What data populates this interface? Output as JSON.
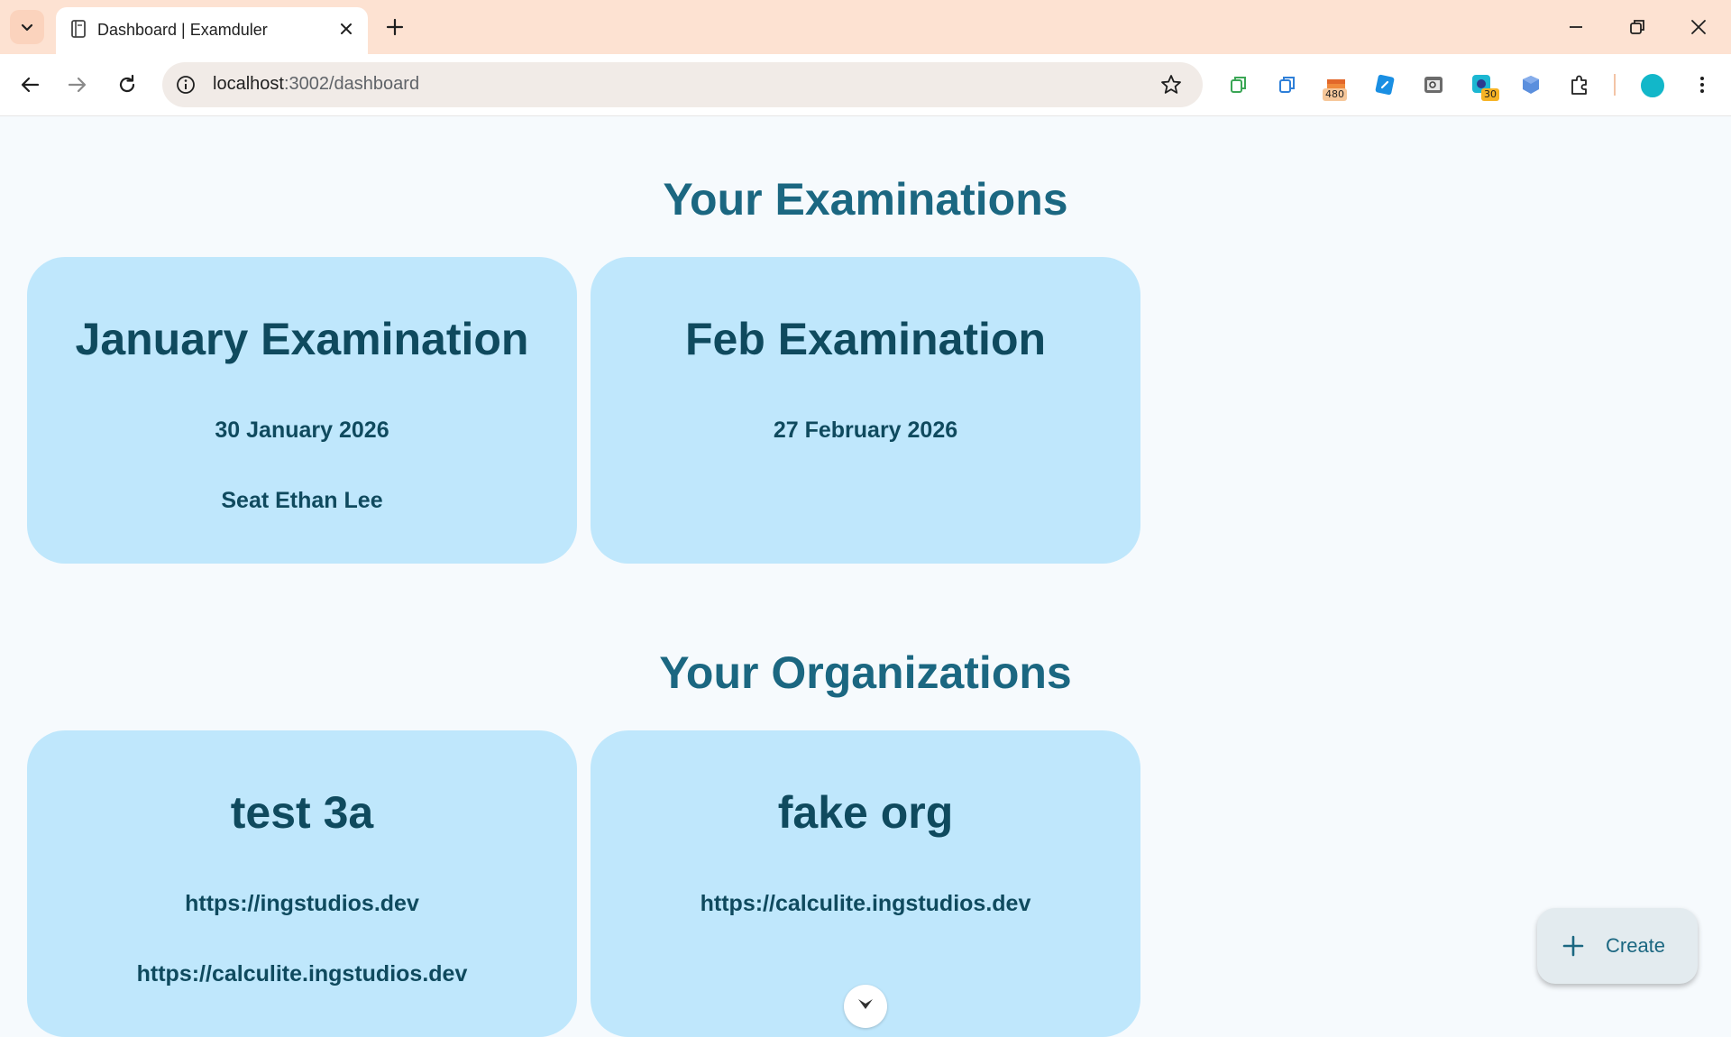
{
  "browser": {
    "tab_title": "Dashboard | Examduler",
    "url_host": "localhost",
    "url_path": ":3002/dashboard",
    "extensions": [
      {
        "icon": "copy-icon-green",
        "badge": ""
      },
      {
        "icon": "copy-icon-blue",
        "badge": ""
      },
      {
        "icon": "gift-icon",
        "badge": "480"
      },
      {
        "icon": "link-icon",
        "badge": ""
      },
      {
        "icon": "lens-icon",
        "badge": ""
      },
      {
        "icon": "color-picker-icon",
        "badge": "30"
      },
      {
        "icon": "cube-icon",
        "badge": ""
      },
      {
        "icon": "puzzle-icon",
        "badge": ""
      }
    ]
  },
  "examinations": {
    "heading": "Your Examinations",
    "cards": [
      {
        "title": "January Examination",
        "date": "30 January 2026",
        "seat": "Seat Ethan Lee"
      },
      {
        "title": "Feb Examination",
        "date": "27 February 2026",
        "seat": ""
      }
    ]
  },
  "organizations": {
    "heading": "Your Organizations",
    "cards": [
      {
        "title": "test 3a",
        "link1": "https://ingstudios.dev",
        "link2": "https://calculite.ingstudios.dev"
      },
      {
        "title": "fake org",
        "link1": "https://calculite.ingstudios.dev",
        "link2": ""
      }
    ]
  },
  "fab": {
    "label": "Create"
  },
  "colors": {
    "heading": "#1b6781",
    "card_bg": "#bfe7fc",
    "card_text": "#0f4a5e",
    "page_bg": "#f6fafd",
    "tabstrip_bg": "#fde2d2"
  }
}
